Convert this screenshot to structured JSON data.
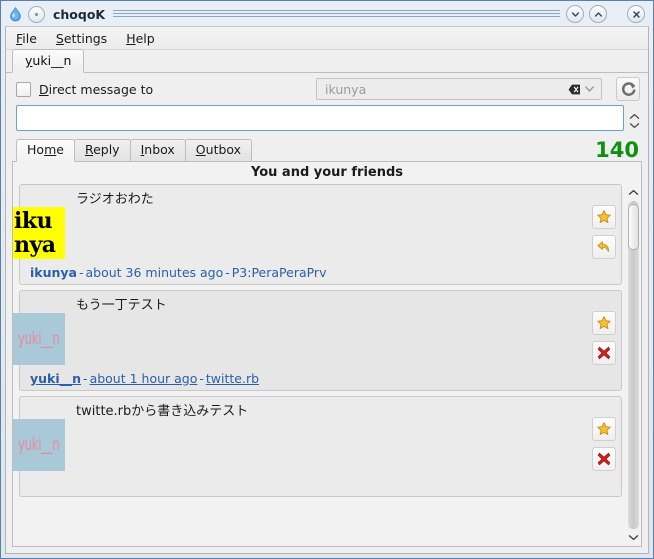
{
  "window": {
    "title": "choqoK",
    "app_icon": "droplet-icon",
    "sticky_button": "sticky-button",
    "buttons": {
      "minimize": "chevron-down-icon",
      "maximize": "chevron-up-icon",
      "close": "close-icon"
    }
  },
  "menubar": {
    "items": [
      {
        "label": "File",
        "accel": "F"
      },
      {
        "label": "Settings",
        "accel": "S"
      },
      {
        "label": "Help",
        "accel": "H"
      }
    ]
  },
  "account_tabs": [
    {
      "label": "yuki__n",
      "accel": "y",
      "active": true
    }
  ],
  "dm_row": {
    "checkbox_label": "Direct message to",
    "checkbox_accel": "D",
    "checked": false,
    "recipient_value": "ikunya",
    "recipient_placeholder": "ikunya",
    "recipient_disabled": true,
    "clear_icon": "clear-text-icon",
    "dropdown_icon": "chevron-down-icon",
    "refresh_icon": "refresh-icon"
  },
  "compose": {
    "value": "",
    "placeholder": "",
    "expand_icon": "chevron-up-icon",
    "collapse_icon": "chevron-down-icon"
  },
  "timeline_tabs": [
    {
      "label": "Home",
      "accel": "m",
      "active": true
    },
    {
      "label": "Reply",
      "accel": "R",
      "active": false
    },
    {
      "label": "Inbox",
      "accel": "I",
      "active": false
    },
    {
      "label": "Outbox",
      "accel": "O",
      "active": false
    }
  ],
  "char_counter": {
    "value": "140",
    "color": "#109010"
  },
  "timeline": {
    "header": "You and your friends",
    "posts": [
      {
        "avatar_kind": "ikunya",
        "avatar_line1": "iku",
        "avatar_line2": "nya",
        "text": "ラジオおわた",
        "author": "ikunya",
        "timestamp": "about 36 minutes ago",
        "source": "P3:PeraPeraPrv",
        "hover": false,
        "actions": [
          {
            "name": "favorite-button",
            "icon": "star-icon"
          },
          {
            "name": "reply-button",
            "icon": "reply-arrow-icon"
          }
        ]
      },
      {
        "avatar_kind": "yuki",
        "avatar_text": "yuki__n",
        "text": "もう一丁テスト",
        "author": "yuki__n",
        "timestamp": "about 1 hour ago",
        "source": "twitte.rb",
        "hover": true,
        "actions": [
          {
            "name": "favorite-button",
            "icon": "star-icon"
          },
          {
            "name": "delete-button",
            "icon": "red-x-icon"
          }
        ]
      },
      {
        "avatar_kind": "yuki",
        "avatar_text": "yuki__n",
        "text": "twitte.rbから書き込みテスト",
        "author": "",
        "timestamp": "",
        "source": "",
        "hover": false,
        "actions": [
          {
            "name": "favorite-button",
            "icon": "star-icon"
          },
          {
            "name": "delete-button",
            "icon": "red-x-icon"
          }
        ]
      }
    ],
    "scrollbar": {
      "up_icon": "chevron-up-icon",
      "down_icon": "chevron-down-icon",
      "thumb_position_pct": 1,
      "thumb_size_pct": 14
    }
  },
  "colors": {
    "link": "#2a5fa8",
    "counter_green": "#109010",
    "avatar_yellow": "#ffff00",
    "avatar_blue": "#a9c8d8",
    "avatar_pink": "#e48ba0",
    "window_border": "#5a7fa8"
  }
}
